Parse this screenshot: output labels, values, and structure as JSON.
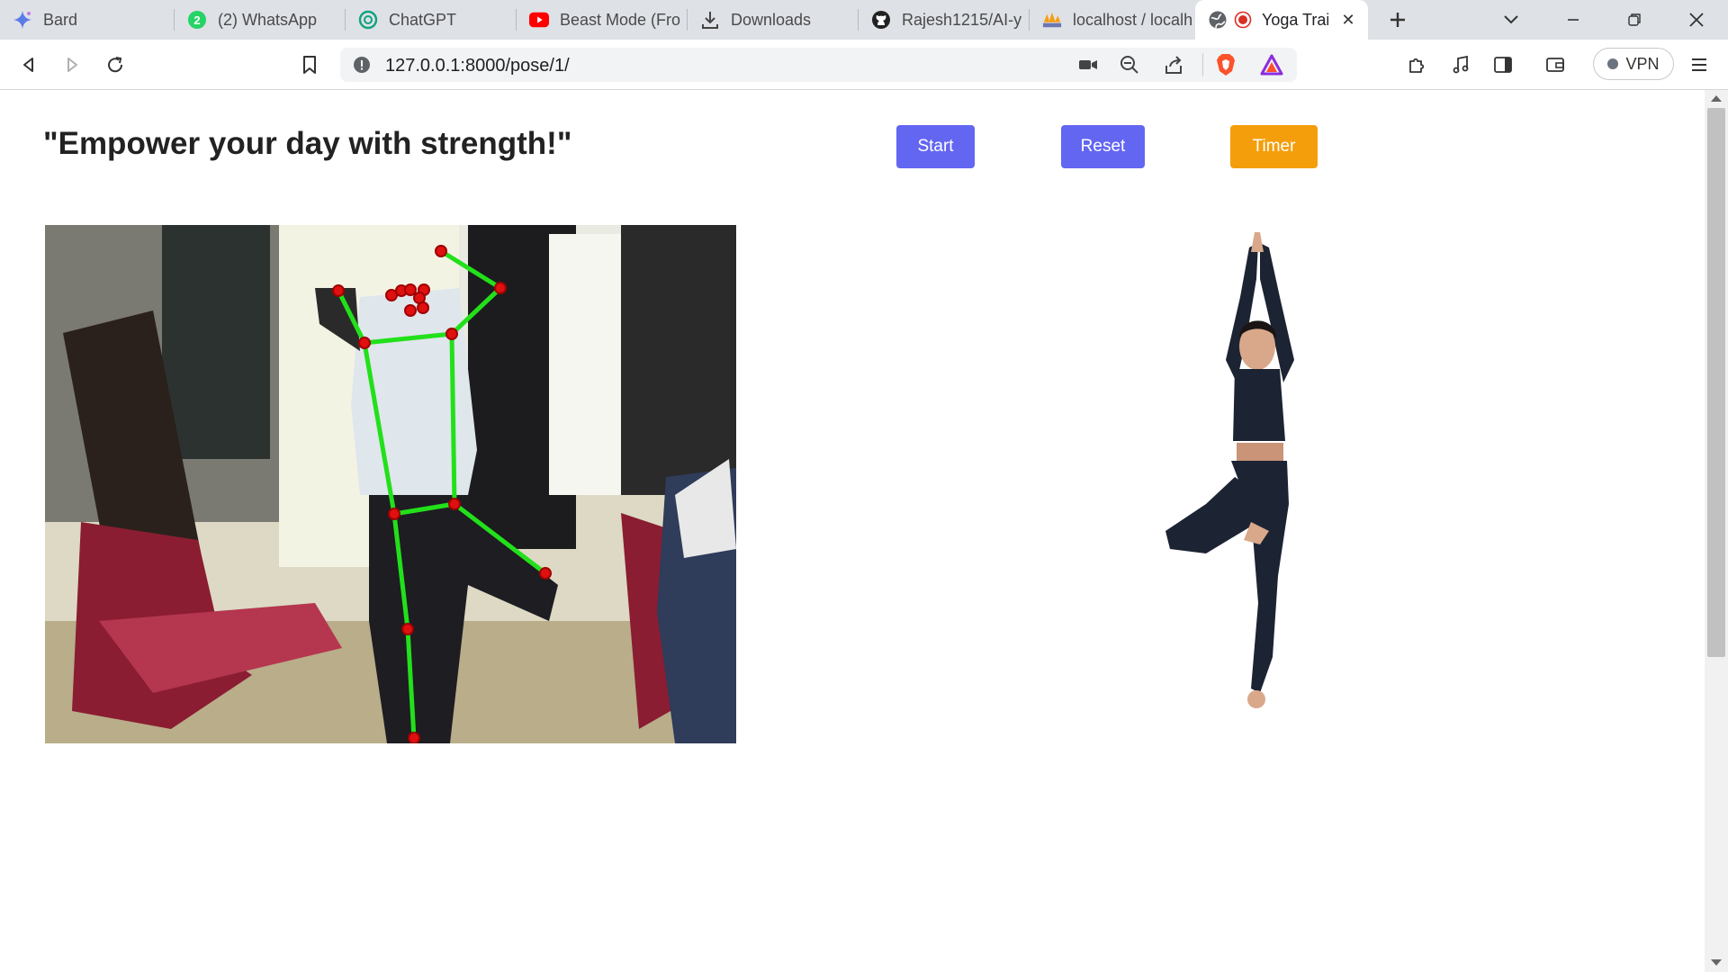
{
  "browser": {
    "tabs": [
      {
        "label": "Bard",
        "icon": "bard-sparkle-icon"
      },
      {
        "label": "(2) WhatsApp",
        "icon": "whatsapp-icon",
        "badge": "2"
      },
      {
        "label": "ChatGPT",
        "icon": "chatgpt-icon"
      },
      {
        "label": "Beast Mode (Fro",
        "icon": "youtube-icon"
      },
      {
        "label": "Downloads",
        "icon": "download-icon"
      },
      {
        "label": "Rajesh1215/AI-y",
        "icon": "github-icon"
      },
      {
        "label": "localhost / localh",
        "icon": "phpmyadmin-icon"
      },
      {
        "label": "Yoga Trai",
        "icon": "globe-icon",
        "active": true
      }
    ],
    "url": "127.0.0.1:8000/pose/1/",
    "vpn_label": "VPN"
  },
  "page": {
    "headline": "\"Empower your day with strength!\"",
    "buttons": {
      "start": "Start",
      "reset": "Reset",
      "timer": "Timer"
    }
  },
  "colors": {
    "primary_button": "#6366f1",
    "timer_button": "#f59e0b",
    "skeleton_line": "#22e01a",
    "skeleton_joint": "#e01010"
  }
}
